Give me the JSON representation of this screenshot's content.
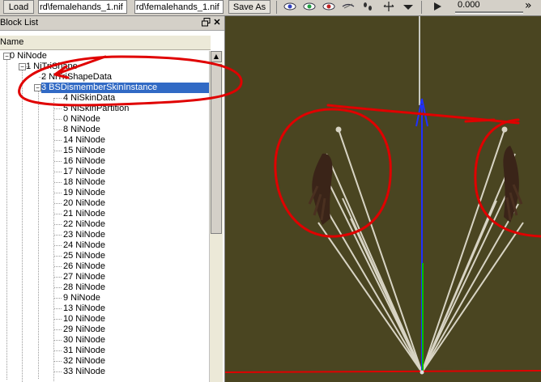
{
  "toolbar": {
    "load_label": "Load",
    "load_path": "rd\\femalehands_1.nif",
    "save_path": "rd\\femalehands_1.nif",
    "save_as_label": "Save As",
    "slider_value": "0.000",
    "overflow_label": "»"
  },
  "block_list": {
    "title": "Block List",
    "column_header": "Name",
    "items": [
      {
        "label": "0 NiNode"
      },
      {
        "label": "1 NiTriShape"
      },
      {
        "label": "2 NiTriShapeData"
      },
      {
        "label": "3 BSDismemberSkinInstance",
        "selected": true
      },
      {
        "label": "4 NiSkinData"
      },
      {
        "label": "5 NiSkinPartition"
      },
      {
        "label": "0 NiNode"
      },
      {
        "label": "8 NiNode"
      },
      {
        "label": "14 NiNode"
      },
      {
        "label": "15 NiNode"
      },
      {
        "label": "16 NiNode"
      },
      {
        "label": "17 NiNode"
      },
      {
        "label": "18 NiNode"
      },
      {
        "label": "19 NiNode"
      },
      {
        "label": "20 NiNode"
      },
      {
        "label": "21 NiNode"
      },
      {
        "label": "22 NiNode"
      },
      {
        "label": "23 NiNode"
      },
      {
        "label": "24 NiNode"
      },
      {
        "label": "25 NiNode"
      },
      {
        "label": "26 NiNode"
      },
      {
        "label": "27 NiNode"
      },
      {
        "label": "28 NiNode"
      },
      {
        "label": "9 NiNode"
      },
      {
        "label": "13 NiNode"
      },
      {
        "label": "10 NiNode"
      },
      {
        "label": "29 NiNode"
      },
      {
        "label": "30 NiNode"
      },
      {
        "label": "31 NiNode"
      },
      {
        "label": "32 NiNode"
      },
      {
        "label": "33 NiNode"
      }
    ]
  },
  "colors": {
    "viewport_bg": "#4a4521",
    "selection": "#316ac5",
    "annotation": "#e00000",
    "axis_blue": "#2030ff",
    "axis_green": "#00c000",
    "bone": "#d8d4c4",
    "hand": "#3a2418"
  }
}
